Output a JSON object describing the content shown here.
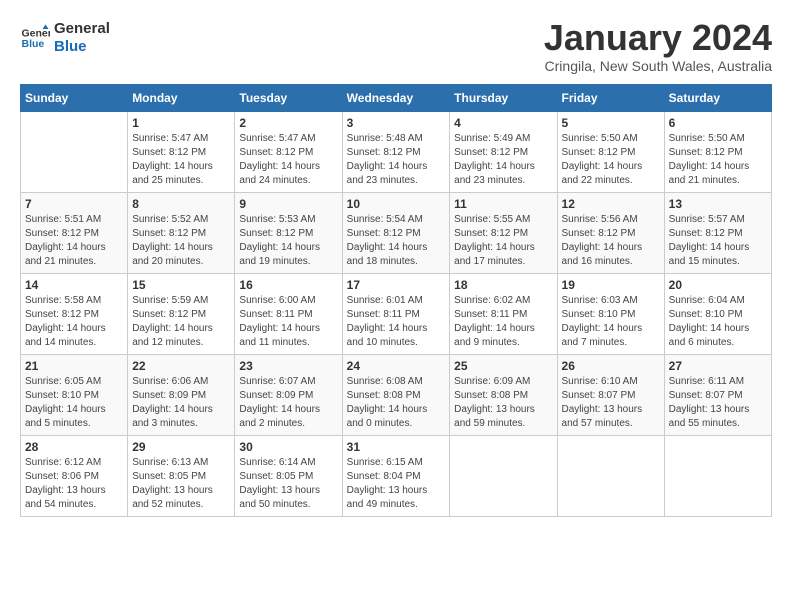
{
  "logo": {
    "line1": "General",
    "line2": "Blue"
  },
  "title": "January 2024",
  "location": "Cringila, New South Wales, Australia",
  "days_of_week": [
    "Sunday",
    "Monday",
    "Tuesday",
    "Wednesday",
    "Thursday",
    "Friday",
    "Saturday"
  ],
  "weeks": [
    [
      {
        "day": "",
        "info": ""
      },
      {
        "day": "1",
        "info": "Sunrise: 5:47 AM\nSunset: 8:12 PM\nDaylight: 14 hours\nand 25 minutes."
      },
      {
        "day": "2",
        "info": "Sunrise: 5:47 AM\nSunset: 8:12 PM\nDaylight: 14 hours\nand 24 minutes."
      },
      {
        "day": "3",
        "info": "Sunrise: 5:48 AM\nSunset: 8:12 PM\nDaylight: 14 hours\nand 23 minutes."
      },
      {
        "day": "4",
        "info": "Sunrise: 5:49 AM\nSunset: 8:12 PM\nDaylight: 14 hours\nand 23 minutes."
      },
      {
        "day": "5",
        "info": "Sunrise: 5:50 AM\nSunset: 8:12 PM\nDaylight: 14 hours\nand 22 minutes."
      },
      {
        "day": "6",
        "info": "Sunrise: 5:50 AM\nSunset: 8:12 PM\nDaylight: 14 hours\nand 21 minutes."
      }
    ],
    [
      {
        "day": "7",
        "info": "Sunrise: 5:51 AM\nSunset: 8:12 PM\nDaylight: 14 hours\nand 21 minutes."
      },
      {
        "day": "8",
        "info": "Sunrise: 5:52 AM\nSunset: 8:12 PM\nDaylight: 14 hours\nand 20 minutes."
      },
      {
        "day": "9",
        "info": "Sunrise: 5:53 AM\nSunset: 8:12 PM\nDaylight: 14 hours\nand 19 minutes."
      },
      {
        "day": "10",
        "info": "Sunrise: 5:54 AM\nSunset: 8:12 PM\nDaylight: 14 hours\nand 18 minutes."
      },
      {
        "day": "11",
        "info": "Sunrise: 5:55 AM\nSunset: 8:12 PM\nDaylight: 14 hours\nand 17 minutes."
      },
      {
        "day": "12",
        "info": "Sunrise: 5:56 AM\nSunset: 8:12 PM\nDaylight: 14 hours\nand 16 minutes."
      },
      {
        "day": "13",
        "info": "Sunrise: 5:57 AM\nSunset: 8:12 PM\nDaylight: 14 hours\nand 15 minutes."
      }
    ],
    [
      {
        "day": "14",
        "info": "Sunrise: 5:58 AM\nSunset: 8:12 PM\nDaylight: 14 hours\nand 14 minutes."
      },
      {
        "day": "15",
        "info": "Sunrise: 5:59 AM\nSunset: 8:12 PM\nDaylight: 14 hours\nand 12 minutes."
      },
      {
        "day": "16",
        "info": "Sunrise: 6:00 AM\nSunset: 8:11 PM\nDaylight: 14 hours\nand 11 minutes."
      },
      {
        "day": "17",
        "info": "Sunrise: 6:01 AM\nSunset: 8:11 PM\nDaylight: 14 hours\nand 10 minutes."
      },
      {
        "day": "18",
        "info": "Sunrise: 6:02 AM\nSunset: 8:11 PM\nDaylight: 14 hours\nand 9 minutes."
      },
      {
        "day": "19",
        "info": "Sunrise: 6:03 AM\nSunset: 8:10 PM\nDaylight: 14 hours\nand 7 minutes."
      },
      {
        "day": "20",
        "info": "Sunrise: 6:04 AM\nSunset: 8:10 PM\nDaylight: 14 hours\nand 6 minutes."
      }
    ],
    [
      {
        "day": "21",
        "info": "Sunrise: 6:05 AM\nSunset: 8:10 PM\nDaylight: 14 hours\nand 5 minutes."
      },
      {
        "day": "22",
        "info": "Sunrise: 6:06 AM\nSunset: 8:09 PM\nDaylight: 14 hours\nand 3 minutes."
      },
      {
        "day": "23",
        "info": "Sunrise: 6:07 AM\nSunset: 8:09 PM\nDaylight: 14 hours\nand 2 minutes."
      },
      {
        "day": "24",
        "info": "Sunrise: 6:08 AM\nSunset: 8:08 PM\nDaylight: 14 hours\nand 0 minutes."
      },
      {
        "day": "25",
        "info": "Sunrise: 6:09 AM\nSunset: 8:08 PM\nDaylight: 13 hours\nand 59 minutes."
      },
      {
        "day": "26",
        "info": "Sunrise: 6:10 AM\nSunset: 8:07 PM\nDaylight: 13 hours\nand 57 minutes."
      },
      {
        "day": "27",
        "info": "Sunrise: 6:11 AM\nSunset: 8:07 PM\nDaylight: 13 hours\nand 55 minutes."
      }
    ],
    [
      {
        "day": "28",
        "info": "Sunrise: 6:12 AM\nSunset: 8:06 PM\nDaylight: 13 hours\nand 54 minutes."
      },
      {
        "day": "29",
        "info": "Sunrise: 6:13 AM\nSunset: 8:05 PM\nDaylight: 13 hours\nand 52 minutes."
      },
      {
        "day": "30",
        "info": "Sunrise: 6:14 AM\nSunset: 8:05 PM\nDaylight: 13 hours\nand 50 minutes."
      },
      {
        "day": "31",
        "info": "Sunrise: 6:15 AM\nSunset: 8:04 PM\nDaylight: 13 hours\nand 49 minutes."
      },
      {
        "day": "",
        "info": ""
      },
      {
        "day": "",
        "info": ""
      },
      {
        "day": "",
        "info": ""
      }
    ]
  ]
}
